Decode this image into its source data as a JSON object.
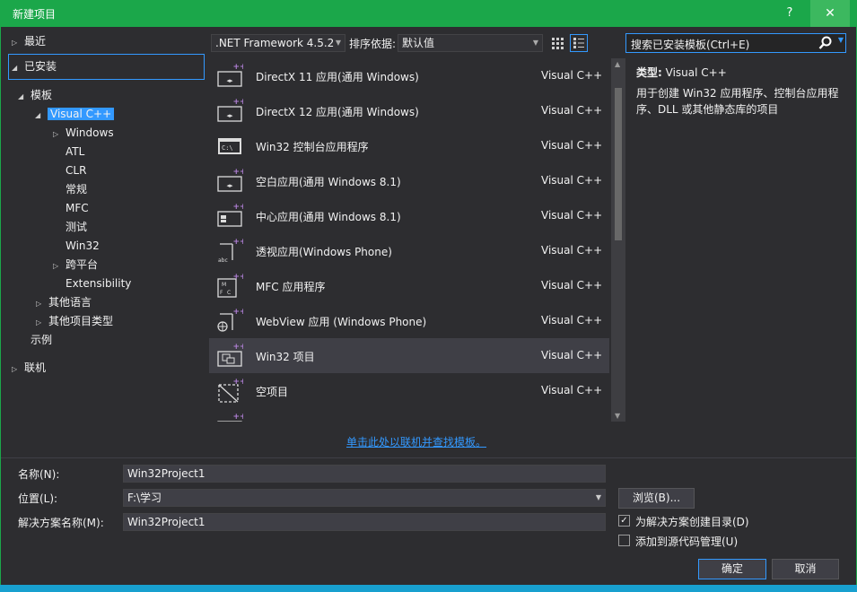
{
  "window": {
    "title": "新建项目",
    "help_label": "?",
    "close_label": "✕"
  },
  "tree": {
    "recent": "最近",
    "installed": "已安装",
    "templates": "模板",
    "visual_cpp": "Visual C++",
    "cpp_children": [
      "Windows",
      "ATL",
      "CLR",
      "常规",
      "MFC",
      "测试",
      "Win32",
      "跨平台",
      "Extensibility"
    ],
    "other_languages": "其他语言",
    "other_project_types": "其他项目类型",
    "samples": "示例",
    "online": "联机"
  },
  "toolbar": {
    "framework": ".NET Framework 4.5.2",
    "sort_label": "排序依据:",
    "sort_value": "默认值",
    "search_placeholder": "搜索已安装模板(Ctrl+E)"
  },
  "templates": [
    {
      "name": "DirectX 11 应用(通用 Windows)",
      "lang": "Visual C++",
      "icon": "directx-app-icon"
    },
    {
      "name": "DirectX 12 应用(通用 Windows)",
      "lang": "Visual C++",
      "icon": "directx-app-icon"
    },
    {
      "name": "Win32 控制台应用程序",
      "lang": "Visual C++",
      "icon": "console-app-icon"
    },
    {
      "name": "空白应用(通用 Windows 8.1)",
      "lang": "Visual C++",
      "icon": "blank-app-icon"
    },
    {
      "name": "中心应用(通用 Windows 8.1)",
      "lang": "Visual C++",
      "icon": "hub-app-icon"
    },
    {
      "name": "透视应用(Windows Phone)",
      "lang": "Visual C++",
      "icon": "pivot-app-icon"
    },
    {
      "name": "MFC 应用程序",
      "lang": "Visual C++",
      "icon": "mfc-app-icon"
    },
    {
      "name": "WebView 应用 (Windows Phone)",
      "lang": "Visual C++",
      "icon": "webview-app-icon"
    },
    {
      "name": "Win32 项目",
      "lang": "Visual C++",
      "icon": "win32-project-icon"
    },
    {
      "name": "空项目",
      "lang": "Visual C++",
      "icon": "empty-project-icon"
    }
  ],
  "selected_template_index": 8,
  "details": {
    "type_label": "类型:",
    "type_value": "Visual C++",
    "description": "用于创建 Win32 应用程序、控制台应用程序、DLL 或其他静态库的项目"
  },
  "online_link": "单击此处以联机并查找模板。",
  "form": {
    "name_label": "名称(N):",
    "name_value": "Win32Project1",
    "location_label": "位置(L):",
    "location_value": "F:\\学习",
    "solution_label": "解决方案名称(M):",
    "solution_value": "Win32Project1",
    "browse_label": "浏览(B)...",
    "create_dir_label": "为解决方案创建目录(D)",
    "create_dir_checked": true,
    "source_control_label": "添加到源代码管理(U)",
    "source_control_checked": false,
    "ok_label": "确定",
    "cancel_label": "取消"
  },
  "colors": {
    "title_bar": "#1ba74a",
    "accent": "#3399ff",
    "background": "#2d2d30",
    "selected_row": "#3f3f46",
    "plus_marks": "#b180d7"
  }
}
